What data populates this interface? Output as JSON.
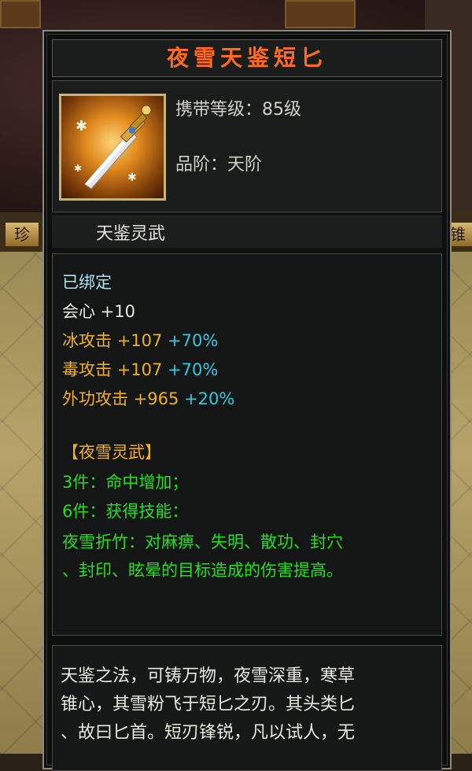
{
  "item": {
    "title": "夜雪天鉴短匕",
    "level_label": "携带等级：85级",
    "grade_label": "品阶：天阶",
    "set_name_header": "天鉴灵武",
    "icon": "dagger-icon"
  },
  "attributes": {
    "bound": "已绑定",
    "crit": {
      "label": "会心",
      "value": "+10"
    },
    "ice_attack": {
      "label": "冰攻击",
      "value": "+107",
      "bonus": "+70%"
    },
    "poison_attack": {
      "label": "毒攻击",
      "value": "+107",
      "bonus": "+70%"
    },
    "external_attack": {
      "label": "外功攻击",
      "value": "+965",
      "bonus": "+20%"
    }
  },
  "set_bonus": {
    "name": "【夜雪灵武】",
    "piece3": "3件：命中增加；",
    "piece6": "6件：获得技能：",
    "skill_line1": "夜雪折竹：对麻痹、失明、散功、封穴",
    "skill_line2": "、封印、眩晕的目标造成的伤害提高。"
  },
  "description": {
    "line1": "天鉴之法，可铸万物，夜雪深重，寒草",
    "line2": "锥心，其雪粉飞于短匕之刃。其头类匕",
    "line3": "、故曰匕首。短刃锋锐，凡以试人，无"
  },
  "background": {
    "left_button": "珍",
    "right_button": "锥"
  },
  "colors": {
    "title": "#ff6a1e",
    "gold_attr": "#f2b01c",
    "bonus_cyan": "#2ccbe6",
    "set_green": "#22e01e",
    "bound_blue": "#a9e2ef"
  }
}
